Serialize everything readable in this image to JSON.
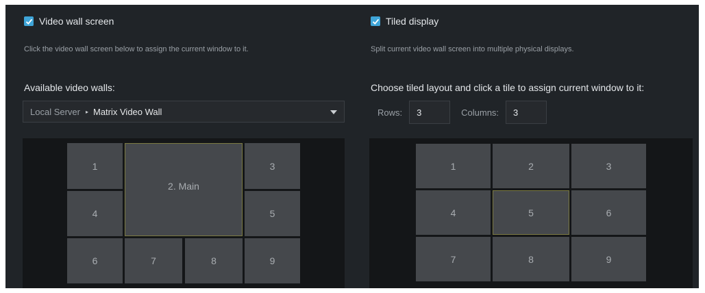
{
  "video_wall": {
    "checkbox_label": "Video wall screen",
    "checked": true,
    "description": "Click the video wall screen below to assign the current window to it.",
    "available_label": "Available video walls:",
    "selector": {
      "server": "Local Server",
      "separator": "▸",
      "wall": "Matrix Video Wall"
    },
    "screens": [
      "1",
      "2. Main",
      "3",
      "4",
      "5",
      "6",
      "7",
      "8",
      "9"
    ],
    "selected_screen": "2. Main"
  },
  "tiled_display": {
    "checkbox_label": "Tiled display",
    "checked": true,
    "description": "Split current video wall screen into multiple physical displays.",
    "layout_label": "Choose tiled layout and click a tile to assign current window to it:",
    "rows_label": "Rows:",
    "rows_value": "3",
    "columns_label": "Columns:",
    "columns_value": "3",
    "tiles": [
      "1",
      "2",
      "3",
      "4",
      "5",
      "6",
      "7",
      "8",
      "9"
    ],
    "selected_tile": "5"
  },
  "colors": {
    "accent": "#3fa5d8",
    "selected_border": "#7c7a42"
  }
}
